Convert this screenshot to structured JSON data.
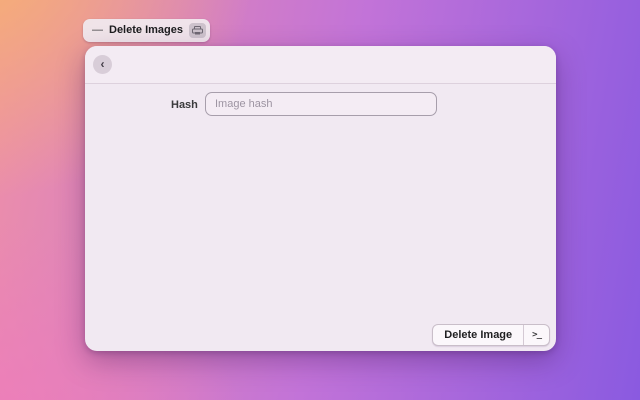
{
  "background": {
    "gradient_colors": [
      "#f3b077",
      "#ee7fbc",
      "#8a5ae0"
    ]
  },
  "tab": {
    "dash": "—",
    "label": "Delete Images",
    "icon": "printer-icon"
  },
  "window": {
    "header": {
      "back_chevron": "‹"
    },
    "form": {
      "hash_label": "Hash",
      "hash_placeholder": "Image hash",
      "hash_value": ""
    },
    "actions": {
      "delete_button_label": "Delete Image",
      "terminal_glyph": ">_"
    }
  }
}
